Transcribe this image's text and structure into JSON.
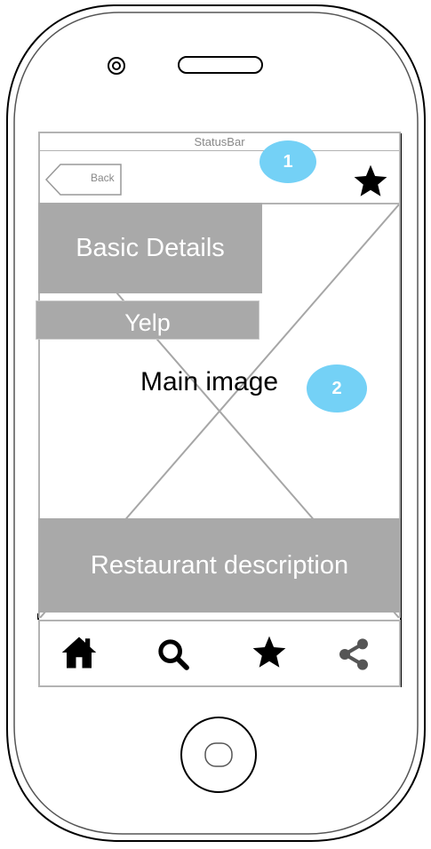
{
  "status_bar": {
    "label": "StatusBar"
  },
  "nav_bar": {
    "back_label": "Back",
    "favorite_icon": "star-icon"
  },
  "markers": {
    "first": "1",
    "second": "2"
  },
  "content": {
    "basic_details": "Basic Details",
    "yelp": "Yelp",
    "main_image": "Main image",
    "description": "Restaurant description"
  },
  "tab_bar": {
    "items": [
      {
        "icon": "home-icon"
      },
      {
        "icon": "search-icon"
      },
      {
        "icon": "star-icon"
      },
      {
        "icon": "share-icon"
      }
    ]
  },
  "colors": {
    "marker": "#74d1f6",
    "block": "#a9a9a9",
    "frame": "#b3b3b3"
  }
}
